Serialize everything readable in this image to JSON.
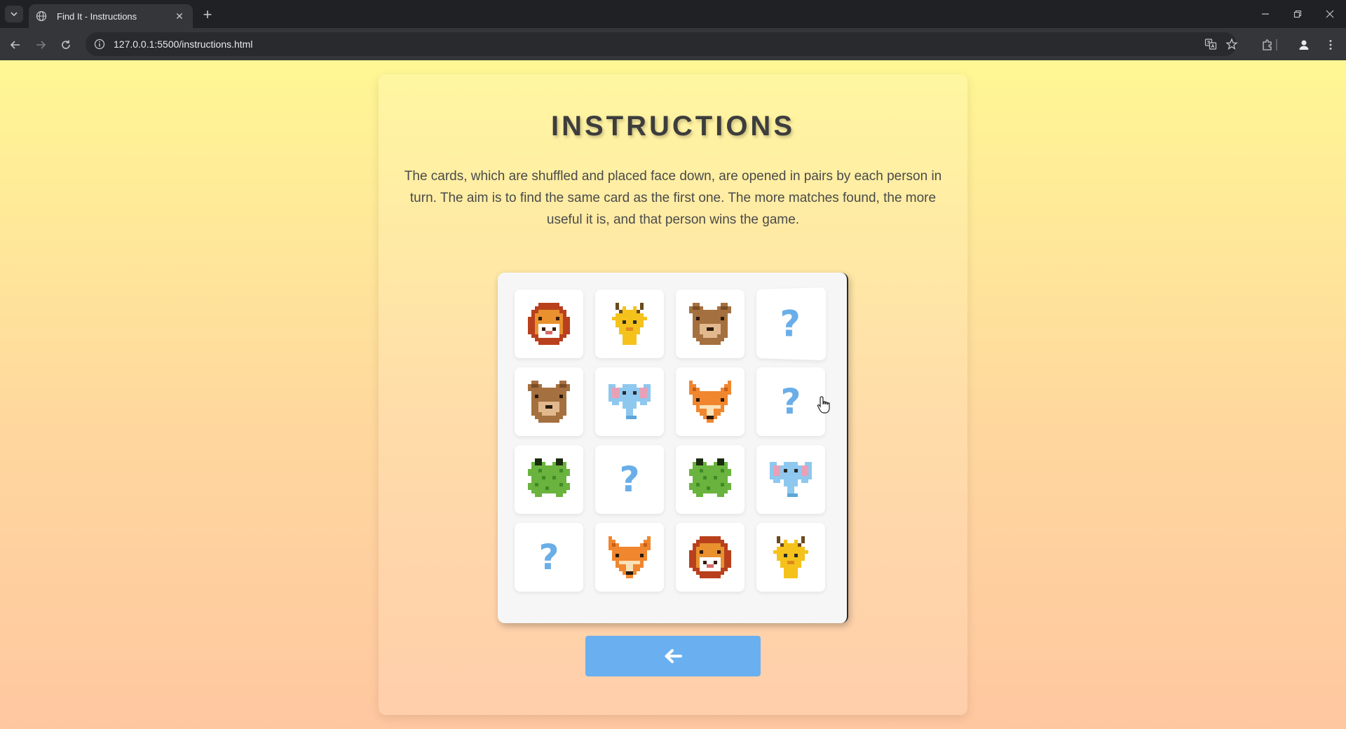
{
  "browser": {
    "tab_title": "Find It - Instructions",
    "url": "127.0.0.1:5500/instructions.html",
    "close_glyph": "✕",
    "new_tab_glyph": "+"
  },
  "page": {
    "title": "INSTRUCTIONS",
    "description": "The cards, which are shuffled and placed face down, are opened in pairs by each person in turn. The aim is to find the same card as the first one. The more matches found, the more useful it is, and that person wins the game.",
    "back_button_icon": "arrow-left-icon"
  },
  "board": {
    "cards": [
      [
        "lion",
        "giraffe",
        "bear",
        "hidden"
      ],
      [
        "bear",
        "elephant",
        "fox",
        "hidden"
      ],
      [
        "frog",
        "hidden",
        "frog",
        "elephant"
      ],
      [
        "hidden",
        "fox",
        "lion",
        "giraffe"
      ]
    ],
    "hidden_glyph": "?",
    "flipping_card": [
      0,
      3
    ]
  },
  "colors": {
    "question_mark": "#6aaee8",
    "back_button": "#6ab0f0",
    "title": "#3d3d3d"
  }
}
